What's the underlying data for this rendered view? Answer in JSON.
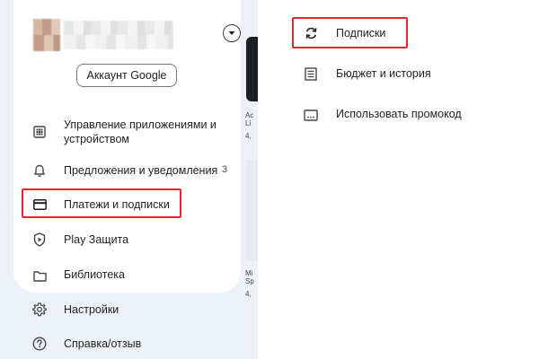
{
  "drawer": {
    "account_button": "Аккаунт Google",
    "items": [
      {
        "label": "Управление приложениями и устройством",
        "icon": "grid-icon"
      },
      {
        "label": "Предложения и уведомления",
        "icon": "bell-icon",
        "count": "3"
      },
      {
        "label": "Платежи и подписки",
        "icon": "credit-card-icon",
        "highlighted": true
      },
      {
        "label": "Play Защита",
        "icon": "shield-icon"
      },
      {
        "label": "Библиотека",
        "icon": "folder-icon"
      },
      {
        "label": "Настройки",
        "icon": "gear-icon"
      },
      {
        "label": "Справка/отзыв",
        "icon": "help-icon"
      }
    ],
    "background_peek": [
      "Ac",
      "Li",
      "4,",
      "Mi",
      "Sp",
      "4,"
    ]
  },
  "submenu": {
    "items": [
      {
        "label": "Подписки",
        "icon": "refresh-icon",
        "highlighted": true
      },
      {
        "label": "Бюджет и история",
        "icon": "list-icon"
      },
      {
        "label": "Использовать промокод",
        "icon": "promo-code-icon"
      }
    ]
  },
  "colors": {
    "highlight": "#e8272c",
    "drawer_background": "#edf1f9",
    "card_background": "#ffffff",
    "text": "#1f1f1f"
  }
}
